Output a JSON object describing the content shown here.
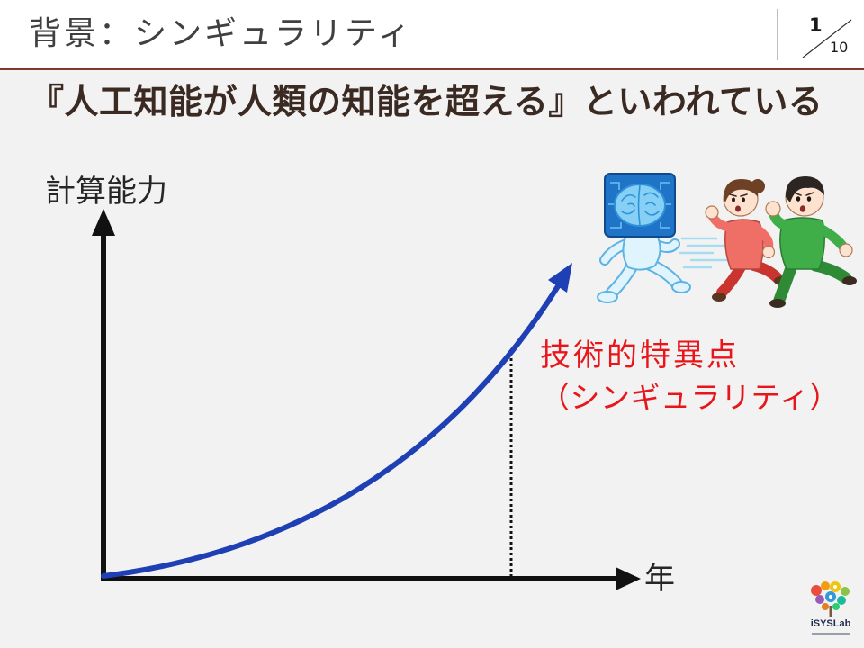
{
  "slide": {
    "title": "背景：シンギュラリティ",
    "page_number": "1",
    "page_total": "10",
    "headline": "『人工知能が人類の知能を超える』といわれている"
  },
  "diagram": {
    "y_axis_label": "計算能力",
    "x_axis_label": "年",
    "annotation": {
      "line1": "技術的特異点",
      "line2": "（シンギュラリティ）"
    }
  },
  "illustration": {
    "icons": [
      "ai-robot-illustration",
      "woman-running-illustration",
      "man-running-illustration"
    ]
  },
  "logo": {
    "icon": "isyslab-logo",
    "text": "iSYSLab"
  },
  "colors": {
    "header_bg": "#ffffff",
    "slide_bg": "#f2f2f2",
    "header_rule": "#7d3a2d",
    "divider": "#bfbfbf",
    "title_text": "#404040",
    "headline_text": "#3b2a22",
    "label_text": "#262626",
    "axis": "#111111",
    "curve": "#1f3fb5",
    "annotation": "#e8161b"
  }
}
